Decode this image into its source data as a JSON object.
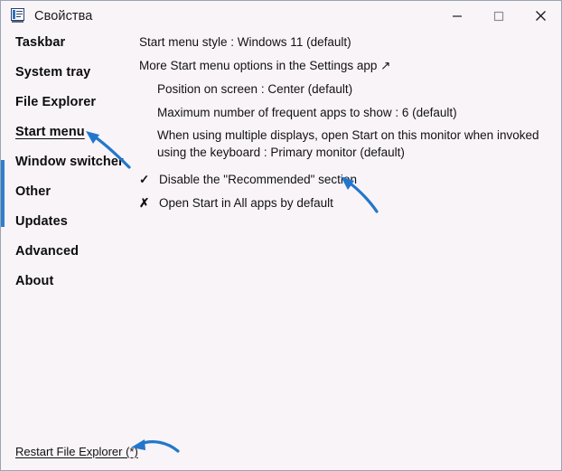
{
  "window": {
    "title": "Свойства",
    "icon": "properties-icon",
    "accent_color": "#2f7fce",
    "background": "#f9f4f8",
    "border_color": "#9aa4b4"
  },
  "titlebar_controls": {
    "minimize": "minimize-button",
    "maximize": "maximize-button",
    "close": "close-button"
  },
  "sidebar": {
    "items": [
      {
        "label": "Taskbar",
        "selected": false
      },
      {
        "label": "System tray",
        "selected": false
      },
      {
        "label": "File Explorer",
        "selected": false
      },
      {
        "label": "Start menu",
        "selected": true
      },
      {
        "label": "Window switcher",
        "selected": false
      },
      {
        "label": "Other",
        "selected": false
      },
      {
        "label": "Updates",
        "selected": false
      },
      {
        "label": "Advanced",
        "selected": false
      },
      {
        "label": "About",
        "selected": false
      }
    ]
  },
  "content": {
    "rows": [
      {
        "text": "Start menu style : Windows 11 (default)",
        "mark": "",
        "indent": 1
      },
      {
        "text": "More Start menu options in the Settings app ↗",
        "mark": "",
        "indent": 1
      },
      {
        "text": "Position on screen : Center (default)",
        "mark": "",
        "indent": 2
      },
      {
        "text": "Maximum number of frequent apps to show : 6 (default)",
        "mark": "",
        "indent": 2
      },
      {
        "text": "When using multiple displays, open Start on this monitor when invoked using the keyboard : Primary monitor (default)",
        "mark": "",
        "indent": 2
      },
      {
        "text": "Disable the \"Recommended\" section",
        "mark": "✓",
        "indent": 1
      },
      {
        "text": "Open Start in All apps by default",
        "mark": "✗",
        "indent": 1
      }
    ]
  },
  "footer": {
    "restart_link": "Restart File Explorer (*)"
  },
  "annotations": {
    "color": "#2277cc",
    "arrows": [
      {
        "name": "arrow-to-start-menu",
        "target": "Start menu"
      },
      {
        "name": "arrow-to-disable-recommended",
        "target": "Disable the \"Recommended\" section"
      },
      {
        "name": "arrow-to-restart-file-explorer",
        "target": "Restart File Explorer (*)"
      }
    ]
  }
}
